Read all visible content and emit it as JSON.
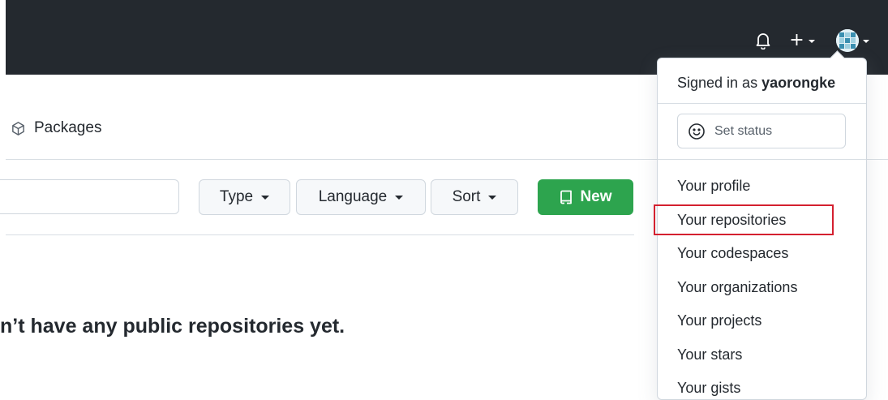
{
  "colors": {
    "header_bg": "#24292f",
    "primary_green": "#2da44e",
    "highlight_red": "#d4202f"
  },
  "header": {
    "actions": [
      {
        "name": "bell-icon",
        "glyph": "bell"
      },
      {
        "name": "plus-icon",
        "glyph": "+"
      },
      {
        "name": "avatar",
        "glyph": "identicon"
      }
    ]
  },
  "subnav": {
    "packages_label": "Packages",
    "packages_icon": "package-icon"
  },
  "filters": {
    "type_label": "Type",
    "language_label": "Language",
    "sort_label": "Sort",
    "new_label": "New",
    "new_icon": "repo-icon"
  },
  "empty_state": {
    "text": "n’t have any public repositories yet."
  },
  "dropdown": {
    "signed_in_prefix": "Signed in as",
    "username": "yaorongke",
    "set_status_label": "Set status",
    "set_status_icon": "smiley-icon",
    "items": [
      {
        "label": "Your profile"
      },
      {
        "label": "Your repositories"
      },
      {
        "label": "Your codespaces"
      },
      {
        "label": "Your organizations"
      },
      {
        "label": "Your projects"
      },
      {
        "label": "Your stars"
      },
      {
        "label": "Your gists"
      }
    ]
  }
}
